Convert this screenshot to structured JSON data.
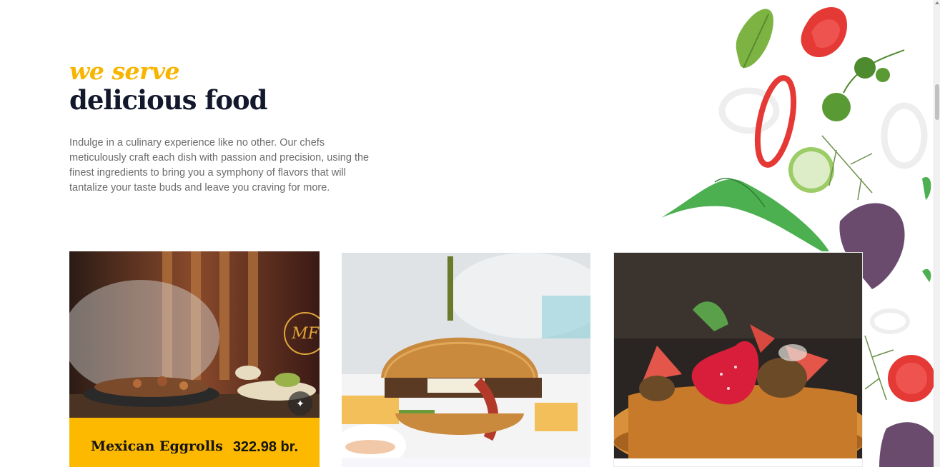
{
  "hero": {
    "eyebrow": "we serve",
    "headline": "delicious food",
    "intro": "Indulge in a culinary experience like no other. Our chefs meticulously craft each dish with passion and precision, using the finest ingredients to bring you a symphony of flavors that will tantalize your taste buds and leave you craving for more."
  },
  "menu": {
    "items": [
      {
        "name": "Mexican Eggrolls",
        "price": "322.98 br.",
        "image": "fajita-sizzling-platter",
        "logo_text": "MF",
        "icon": "magic-wand-icon"
      },
      {
        "image": "bacon-burger-with-fries"
      },
      {
        "image": "pancakes-with-strawberries-and-caramel"
      }
    ]
  },
  "colors": {
    "accent": "#fcb900",
    "eyebrow": "#f7b500",
    "headline": "#13182c",
    "body_text": "#6c6c6c"
  }
}
